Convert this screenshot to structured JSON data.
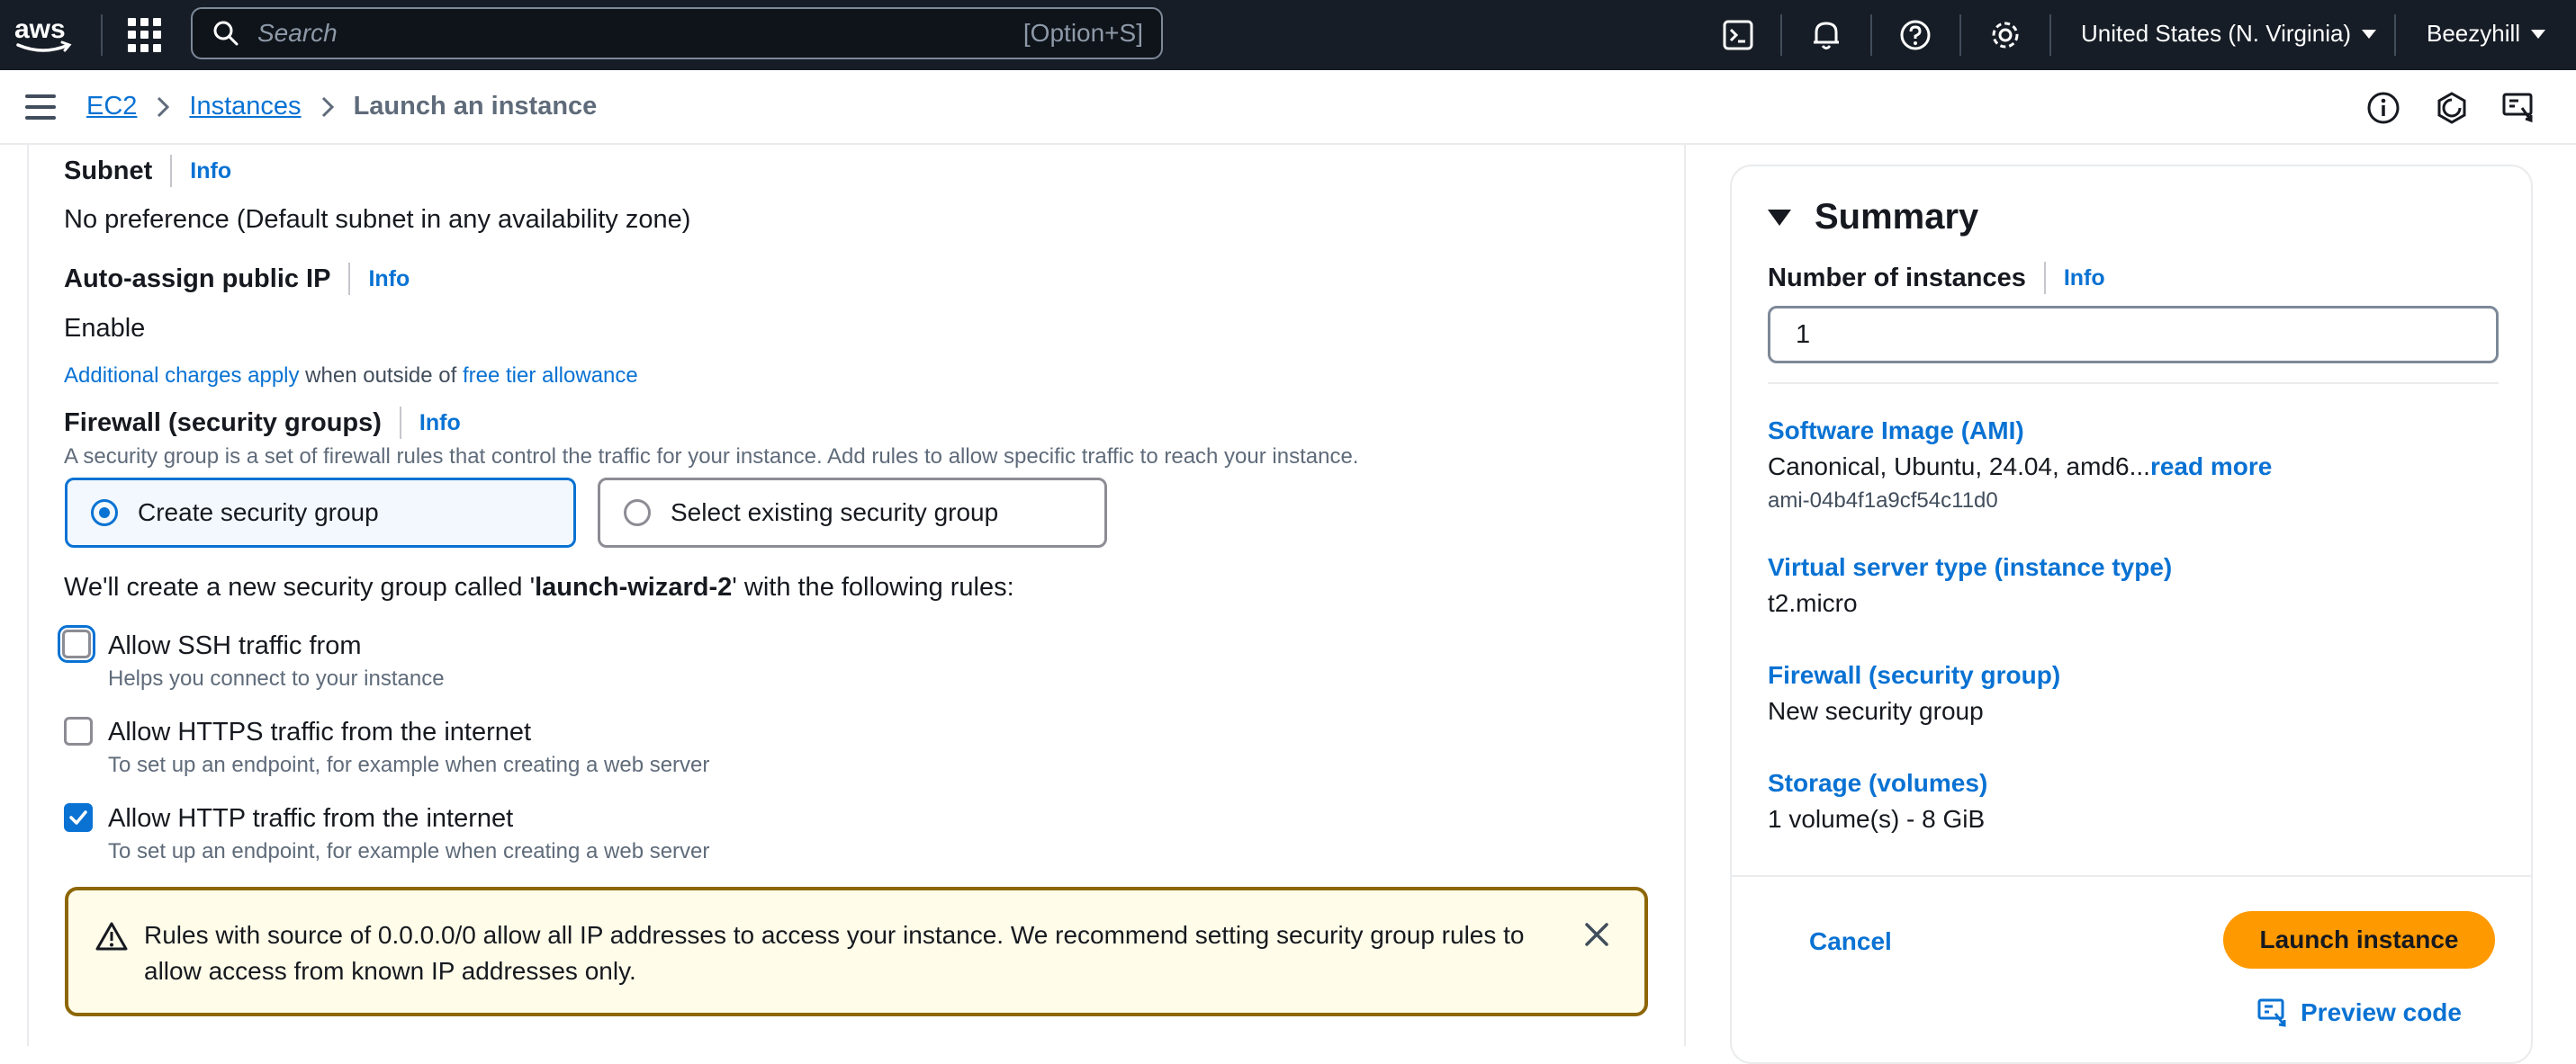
{
  "topnav": {
    "logo": "aws",
    "search_placeholder": "Search",
    "search_shortcut": "[Option+S]",
    "region": "United States (N. Virginia)",
    "account": "Beezyhill",
    "icons": [
      "cloudshell-icon",
      "bell-icon",
      "help-icon",
      "gear-icon"
    ]
  },
  "breadcrumb": {
    "items": [
      "EC2",
      "Instances"
    ],
    "current": "Launch an instance"
  },
  "network": {
    "subnet_label": "Subnet",
    "subnet_info": "Info",
    "subnet_value": "No preference (Default subnet in any availability zone)",
    "public_ip_label": "Auto-assign public IP",
    "public_ip_info": "Info",
    "public_ip_value": "Enable",
    "charges_link": "Additional charges apply",
    "charges_mid": " when outside of ",
    "free_tier_link": "free tier allowance",
    "firewall_label": "Firewall (security groups)",
    "firewall_info": "Info",
    "firewall_desc": "A security group is a set of firewall rules that control the traffic for your instance. Add rules to allow specific traffic to reach your instance.",
    "option_create": "Create security group",
    "option_select": "Select existing security group",
    "create_msg_pre": "We'll create a new security group called '",
    "create_msg_name": "launch-wizard-2",
    "create_msg_post": "' with the following rules:",
    "rules": [
      {
        "label": "Allow SSH traffic from",
        "desc": "Helps you connect to your instance",
        "checked": false
      },
      {
        "label": "Allow HTTPS traffic from the internet",
        "desc": "To set up an endpoint, for example when creating a web server",
        "checked": false
      },
      {
        "label": "Allow HTTP traffic from the internet",
        "desc": "To set up an endpoint, for example when creating a web server",
        "checked": true
      }
    ],
    "warning": "Rules with source of 0.0.0.0/0 allow all IP addresses to access your instance. We recommend setting security group rules to allow access from known IP addresses only."
  },
  "summary": {
    "title": "Summary",
    "num_label": "Number of instances",
    "num_info": "Info",
    "num_value": "1",
    "ami_label": "Software Image (AMI)",
    "ami_value": "Canonical, Ubuntu, 24.04, amd6...",
    "ami_read_more": "read more",
    "ami_id": "ami-04b4f1a9cf54c11d0",
    "type_label": "Virtual server type (instance type)",
    "type_value": "t2.micro",
    "fw_label": "Firewall (security group)",
    "fw_value": "New security group",
    "storage_label": "Storage (volumes)",
    "storage_value": "1 volume(s) - 8 GiB",
    "cancel": "Cancel",
    "launch": "Launch instance",
    "preview": "Preview code"
  },
  "colors": {
    "link": "#0972d3",
    "accent": "#ff9900",
    "nav_bg": "#161d26",
    "warning_border": "#8d6605"
  }
}
